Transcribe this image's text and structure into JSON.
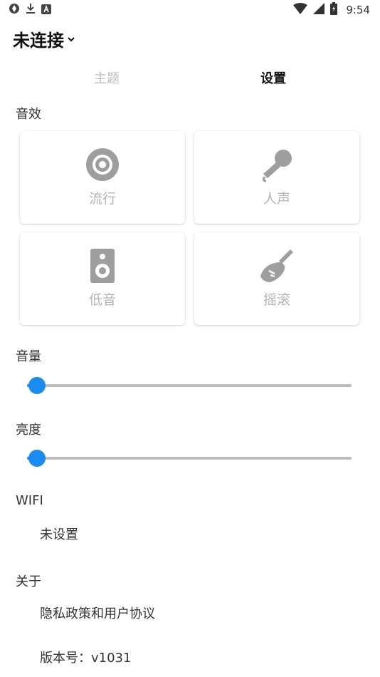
{
  "status_bar": {
    "time": "9:54",
    "left_icons": [
      "sync-icon",
      "download-icon",
      "app-notification-icon"
    ],
    "right_icons": [
      "wifi-icon",
      "signal-icon",
      "battery-icon"
    ]
  },
  "header": {
    "title": "未连接",
    "dropdown_icon": "chevron-down-icon"
  },
  "tabs": [
    {
      "label": "主题",
      "active": false
    },
    {
      "label": "设置",
      "active": true
    }
  ],
  "sound_effects": {
    "title": "音效",
    "items": [
      {
        "label": "流行",
        "icon": "speaker-cone-icon"
      },
      {
        "label": "人声",
        "icon": "microphone-icon"
      },
      {
        "label": "低音",
        "icon": "bass-speaker-icon"
      },
      {
        "label": "摇滚",
        "icon": "guitar-icon"
      }
    ]
  },
  "volume": {
    "title": "音量",
    "value_percent": 3
  },
  "brightness": {
    "title": "亮度",
    "value_percent": 3
  },
  "wifi": {
    "title": "WIFI",
    "value": "未设置"
  },
  "about": {
    "title": "关于",
    "privacy": "隐私政策和用户协议",
    "version": "版本号：v1031"
  },
  "colors": {
    "accent": "#1a8cf0",
    "track": "#bdbdbd",
    "icon_gray": "#9e9e9e",
    "label_gray": "#b5b5b5"
  }
}
